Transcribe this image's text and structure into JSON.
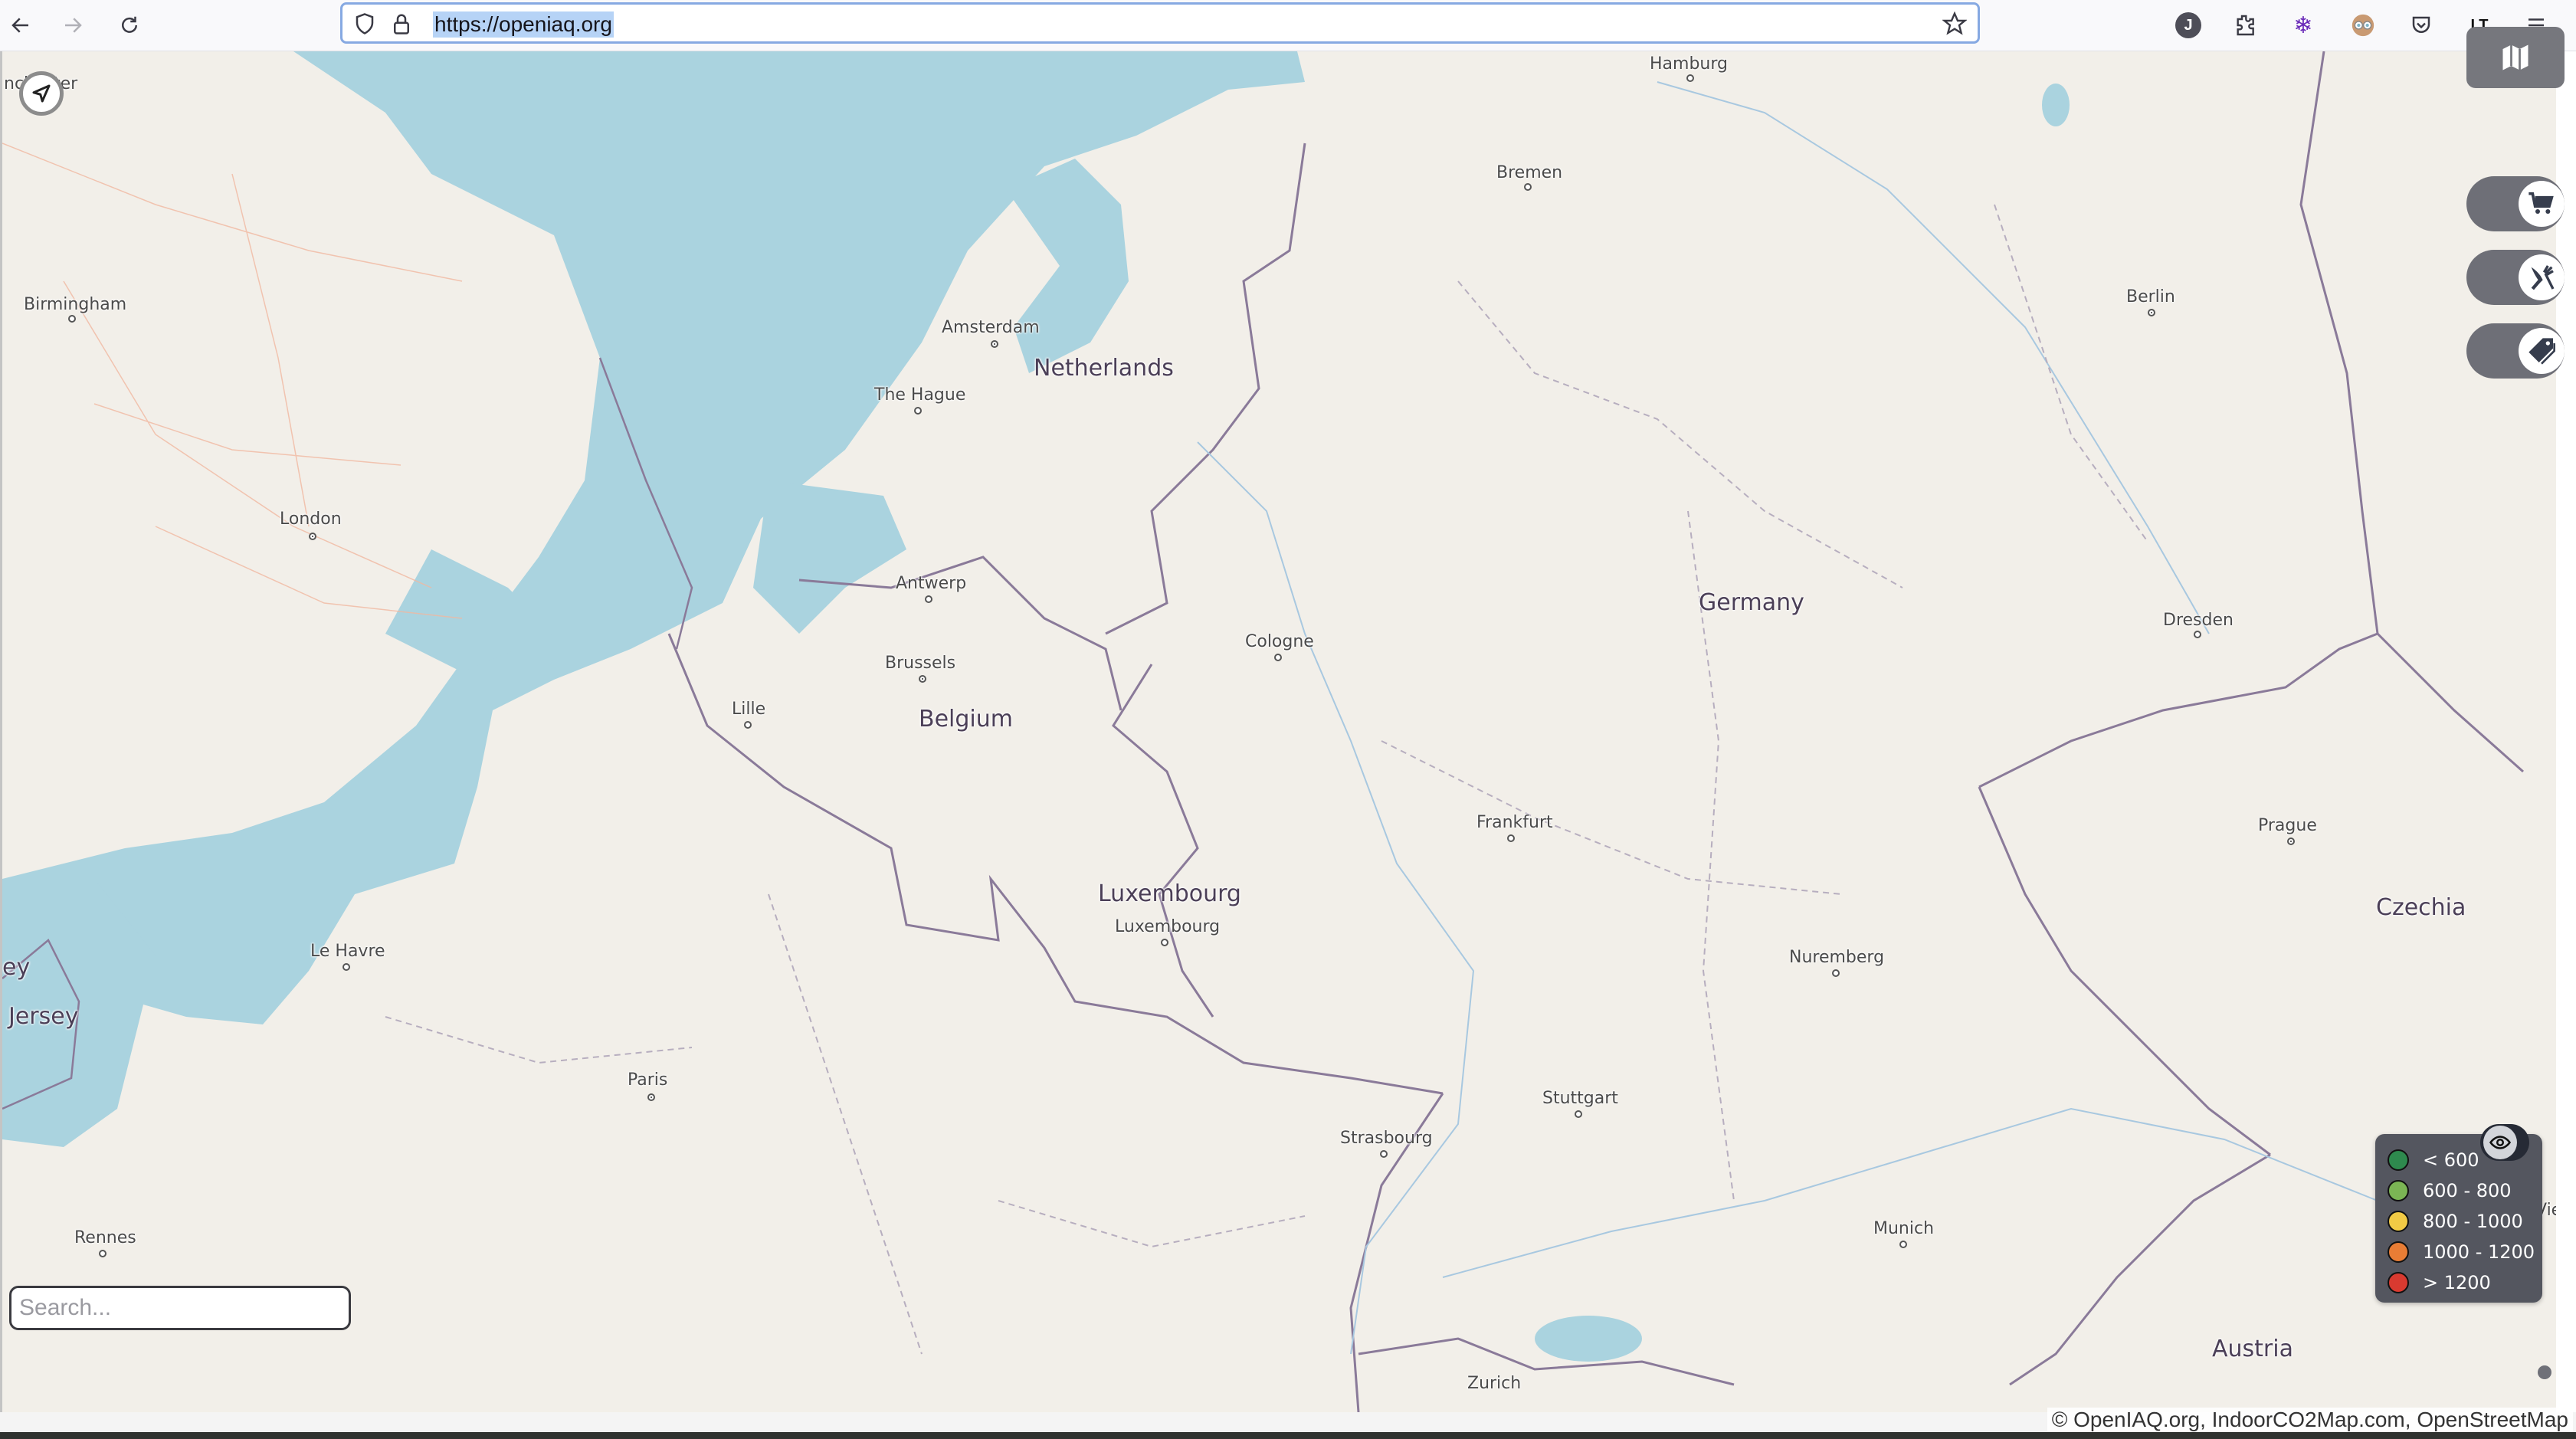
{
  "browser": {
    "url": "https://openiaq.org",
    "nav": {
      "back": "back-arrow",
      "forward": "forward-arrow",
      "reload": "reload"
    },
    "extensions": [
      {
        "name": "profile-j",
        "text": "J"
      },
      {
        "name": "extensions-puzzle",
        "text": ""
      },
      {
        "name": "snowflake-extension",
        "text": ""
      },
      {
        "name": "glasses-face-extension",
        "text": ""
      },
      {
        "name": "pocket",
        "text": ""
      },
      {
        "name": "languagetool",
        "text": "LT"
      },
      {
        "name": "menu",
        "text": ""
      }
    ]
  },
  "map": {
    "controls": {
      "locate": "locate-me",
      "layer_switch": "map-layers",
      "toggles": [
        {
          "name": "shops",
          "icon": "cart"
        },
        {
          "name": "restaurants",
          "icon": "fork-knife"
        },
        {
          "name": "tags",
          "icon": "tag"
        }
      ]
    },
    "labels": {
      "cities": [
        {
          "name": "Hamburg"
        },
        {
          "name": "Bremen"
        },
        {
          "name": "Berlin"
        },
        {
          "name": "Birmingham"
        },
        {
          "name": "Amsterdam"
        },
        {
          "name": "The Hague"
        },
        {
          "name": "London"
        },
        {
          "name": "Antwerp"
        },
        {
          "name": "Brussels"
        },
        {
          "name": "Cologne"
        },
        {
          "name": "Dresden"
        },
        {
          "name": "Lille"
        },
        {
          "name": "Frankfurt"
        },
        {
          "name": "Prague"
        },
        {
          "name": "Luxembourg"
        },
        {
          "name": "Le Havre"
        },
        {
          "name": "Nuremberg"
        },
        {
          "name": "Paris"
        },
        {
          "name": "Stuttgart"
        },
        {
          "name": "Strasbourg"
        },
        {
          "name": "Rennes"
        },
        {
          "name": "Munich"
        },
        {
          "name": "Zurich"
        },
        {
          "name": "Vie"
        },
        {
          "name": "nchester"
        },
        {
          "name": "ey"
        }
      ],
      "countries": [
        {
          "name": "Netherlands"
        },
        {
          "name": "Germany"
        },
        {
          "name": "Belgium"
        },
        {
          "name": "Luxembourg"
        },
        {
          "name": "Czechia"
        },
        {
          "name": "Jersey"
        },
        {
          "name": "Austria"
        }
      ]
    },
    "legend": {
      "items": [
        {
          "label": "< 600",
          "color": "#2e8a4e"
        },
        {
          "label": "600 - 800",
          "color": "#7bb554"
        },
        {
          "label": "800 - 1000",
          "color": "#f2cb45"
        },
        {
          "label": "1000 - 1200",
          "color": "#e87d35"
        },
        {
          "label": "> 1200",
          "color": "#d93a30"
        }
      ],
      "visibility_toggle": "eye"
    },
    "search": {
      "placeholder": "Search...",
      "value": ""
    },
    "attribution": "© OpenIAQ.org, IndoorCO2Map.com, OpenStreetMap",
    "colors": {
      "land": "#f2efe9",
      "water": "#aad3df",
      "border": "#8a7a99"
    }
  }
}
